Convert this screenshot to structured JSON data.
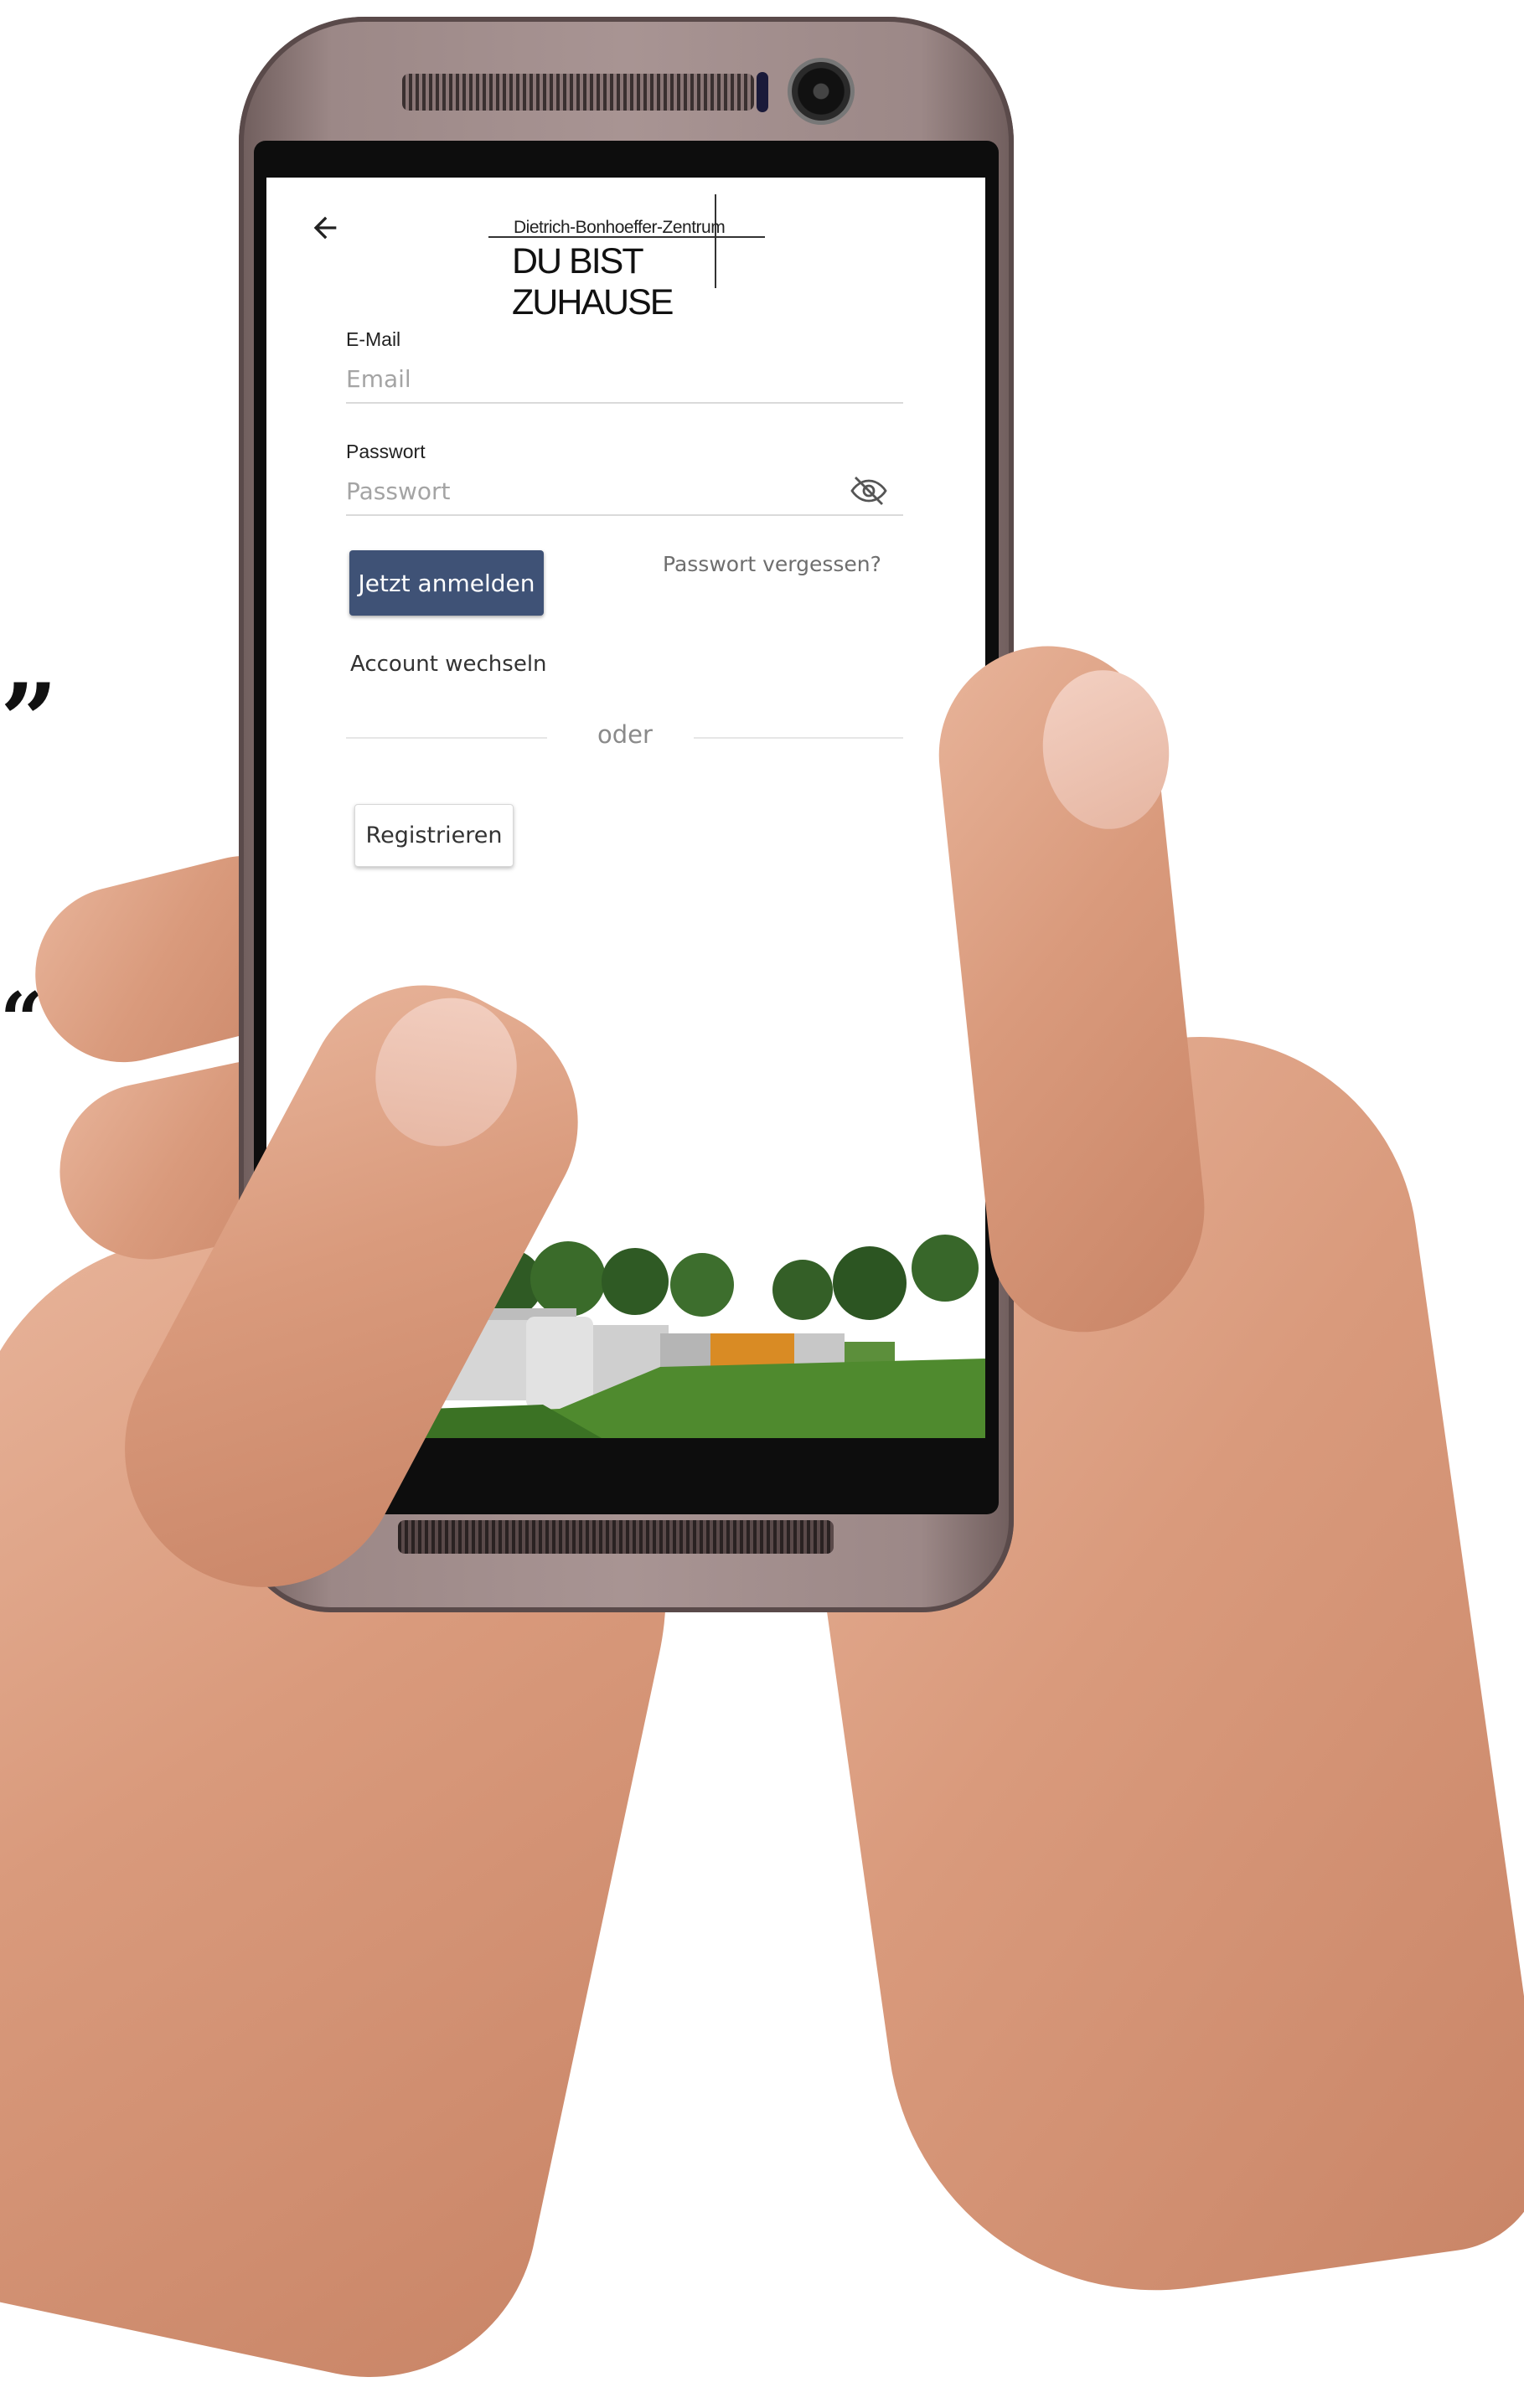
{
  "decor": {
    "quote_close": "”",
    "quote_open": "“"
  },
  "app": {
    "logo": {
      "subtitle": "Dietrich-Bonhoeffer-Zentrum",
      "title": "DU BIST ZUHAUSE"
    },
    "back_icon": "arrow-left-icon",
    "email": {
      "label": "E-Mail",
      "placeholder": "Email",
      "value": ""
    },
    "password": {
      "label": "Passwort",
      "placeholder": "Passwort",
      "value": "",
      "visibility_icon": "eye-off-icon"
    },
    "login_button": "Jetzt anmelden",
    "forgot_password": "Passwort vergessen?",
    "switch_account": "Account wechseln",
    "divider": "oder",
    "register_button": "Registrieren"
  },
  "colors": {
    "primary": "#3f5276",
    "text": "#222222",
    "muted": "#8a8a8a",
    "placeholder": "#a4a4a4"
  }
}
